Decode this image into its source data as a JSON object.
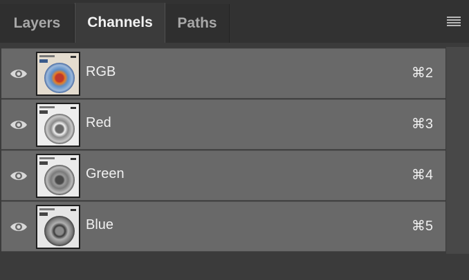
{
  "tabs": [
    {
      "label": "Layers",
      "active": false
    },
    {
      "label": "Channels",
      "active": true
    },
    {
      "label": "Paths",
      "active": false
    }
  ],
  "panel_menu_icon": "hamburger-menu-icon",
  "channels": [
    {
      "name": "RGB",
      "shortcut": "⌘2",
      "visible": true,
      "thumb": "color"
    },
    {
      "name": "Red",
      "shortcut": "⌘3",
      "visible": true,
      "thumb": "gray-light"
    },
    {
      "name": "Green",
      "shortcut": "⌘4",
      "visible": true,
      "thumb": "gray-mid"
    },
    {
      "name": "Blue",
      "shortcut": "⌘5",
      "visible": true,
      "thumb": "gray-dark"
    }
  ],
  "colors": {
    "row_bg": "#696969",
    "panel_bg": "#3b3b3b",
    "text": "#f0f0f0"
  }
}
